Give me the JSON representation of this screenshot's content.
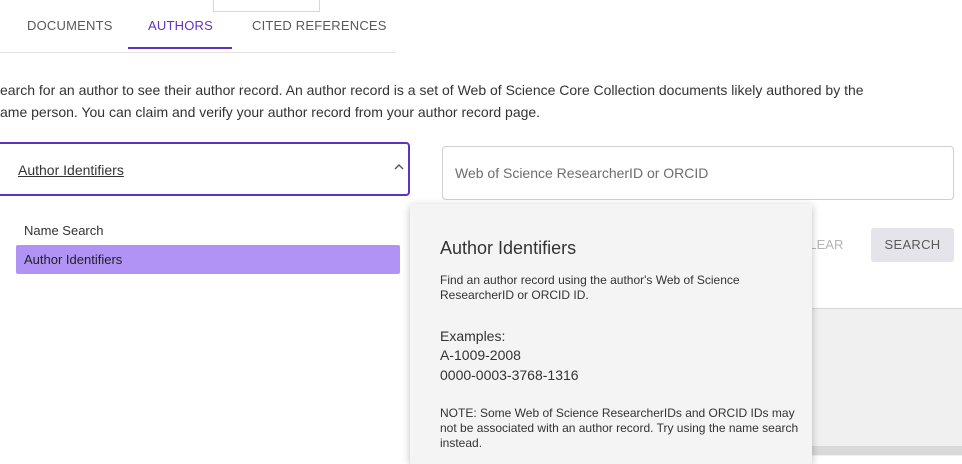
{
  "tabs": [
    {
      "label": "DOCUMENTS"
    },
    {
      "label": "AUTHORS"
    },
    {
      "label": "CITED REFERENCES"
    }
  ],
  "description": {
    "line1": "earch for an author to see their author record. An author record is a set of Web of Science Core Collection documents likely authored by the",
    "line2": "ame person. You can claim and verify your author record from your author record page."
  },
  "search_type": {
    "selected": "Author Identifiers",
    "options": [
      "Name Search",
      "Author Identifiers"
    ]
  },
  "search_input": {
    "placeholder": "Web of Science ResearcherID or ORCID",
    "value": ""
  },
  "buttons": {
    "clear": "CLEAR",
    "search": "SEARCH"
  },
  "tooltip": {
    "title": "Author Identifiers",
    "text": "Find an author record using the author's Web of Science ResearcherID or ORCID ID.",
    "examples_heading": "Examples:",
    "examples": [
      "A-1009-2008",
      "0000-0003-3768-1316"
    ],
    "note": "NOTE: Some Web of Science ResearcherIDs and ORCID IDs may not be associated with an author record. Try using the name search instead."
  },
  "colors": {
    "accent": "#5e33bf",
    "selected_option": "#b093f5",
    "tooltip_bg": "#f4f4f4"
  }
}
